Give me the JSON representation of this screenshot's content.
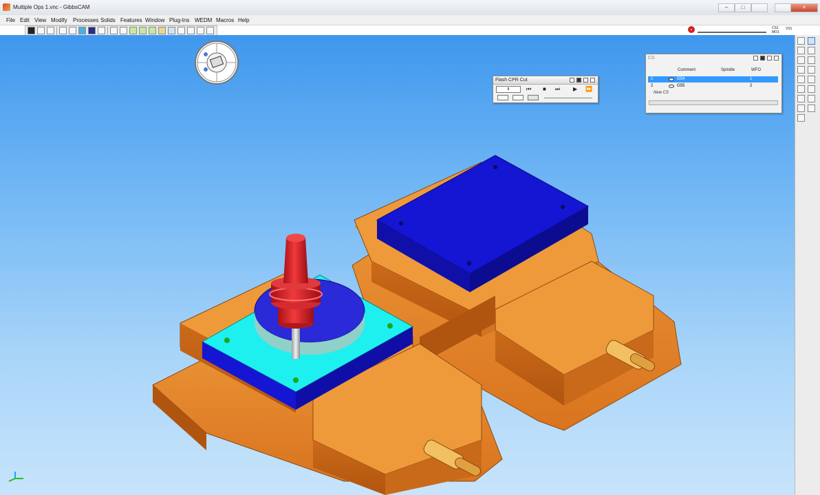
{
  "window": {
    "title": "Multiple Ops 1.vnc - GibbsCAM",
    "minimize": "–",
    "maximize": "□",
    "close": "×"
  },
  "menu": [
    "File",
    "Edit",
    "View",
    "Modify",
    "Processes",
    "Solids",
    "Features",
    "Window",
    "Plug-Ins",
    "WEDM",
    "Macros",
    "Help"
  ],
  "status": {
    "cs_top": "CS1",
    "cs_bottom": "MO1",
    "vs": "VS1",
    "stop_icon": "stop-icon"
  },
  "flash_palette": {
    "title": "Flash CPR Cut",
    "field_value": "8",
    "controls": [
      "⏮",
      "■",
      "⏭",
      "▶",
      "⏩"
    ]
  },
  "cs_palette": {
    "title": "CS",
    "headers": [
      "Comment",
      "Spindle",
      "WFO"
    ],
    "rows": [
      {
        "num": "1",
        "name": "G54",
        "wfo": "1",
        "selected": true
      },
      {
        "num": "2",
        "name": "G55",
        "wfo": "2",
        "selected": false
      }
    ],
    "new_label": "New CS"
  },
  "colors": {
    "viewport_top": "#3f97ee",
    "viewport_bottom": "#c7e4fb",
    "vise": "#e2802a",
    "workpiece": "#1515d4",
    "fixture_plate": "#1ef0f0",
    "tool_holder": "#d41f26",
    "selection": "#3399ff"
  }
}
